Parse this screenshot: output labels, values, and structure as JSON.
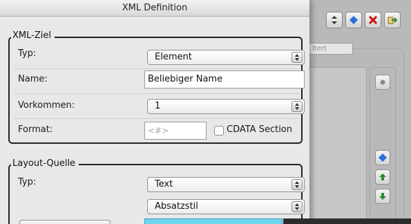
{
  "dialog": {
    "title": "XML Definition"
  },
  "xml_ziel": {
    "group_label": "XML-Ziel",
    "typ_label": "Typ:",
    "typ_value": "Element",
    "name_label": "Name:",
    "name_value": "Beliebiger Name",
    "vorkommen_label": "Vorkommen:",
    "vorkommen_value": "1",
    "format_label": "Format:",
    "format_placeholder": "<#>",
    "cdata_label": "CDATA Section"
  },
  "layout_quelle": {
    "group_label": "Layout-Quelle",
    "typ_label": "Typ:",
    "typ_value": "Text",
    "stil_value": "Absatzstil"
  },
  "background": {
    "tab_label": "ltert",
    "toolbar_icons": [
      "stepper-icon",
      "add-icon",
      "delete-icon",
      "export-icon"
    ],
    "side_icons": [
      "dot-icon",
      "add-icon",
      "arrow-up-icon",
      "arrow-down-icon"
    ]
  },
  "colors": {
    "delete": "#cc1111",
    "add": "#2a6fd6",
    "arrow": "#2a8a2a",
    "selection": "#6fd6f0"
  }
}
